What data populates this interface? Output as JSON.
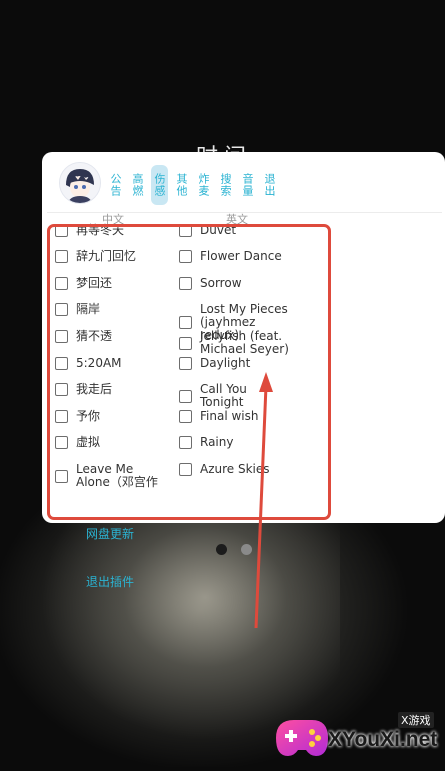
{
  "header": {
    "title": "时间"
  },
  "tabs": [
    {
      "label": "公告",
      "active": false
    },
    {
      "label": "高燃",
      "active": false
    },
    {
      "label": "伤感",
      "active": true
    },
    {
      "label": "其他",
      "active": false
    },
    {
      "label": "炸麦",
      "active": false
    },
    {
      "label": "搜索",
      "active": false
    },
    {
      "label": "音量",
      "active": false
    },
    {
      "label": "退出",
      "active": false
    }
  ],
  "columns": {
    "chinese": "中文",
    "english": "英文"
  },
  "chinese_songs": [
    "再等冬天",
    "辞九门回忆",
    "梦回还",
    "隔岸",
    "猜不透",
    "5:20AM",
    "我走后",
    "予你",
    "虚拟",
    "Leave Me Alone（邓宫作"
  ],
  "english_songs": [
    "Duvet",
    "Flower Dance",
    "Sorrow",
    "Lost My Pieces (jayhmez redux)",
    "Jellyfish (feat. Michael Seyer)",
    "Daylight",
    "Call You Tonight",
    "Final wish",
    "Rainy",
    "Azure Skies"
  ],
  "links": {
    "cloud_update": "网盘更新",
    "exit_plugin": "退出插件"
  },
  "pager": {
    "active_index": 1,
    "count": 2
  },
  "watermark": {
    "brand": "XYouXi.net",
    "tag": "X游戏"
  },
  "colors": {
    "accent": "#2bb3d2",
    "highlight": "#de4a3c",
    "tab_active_bg": "#c9e7f3"
  }
}
